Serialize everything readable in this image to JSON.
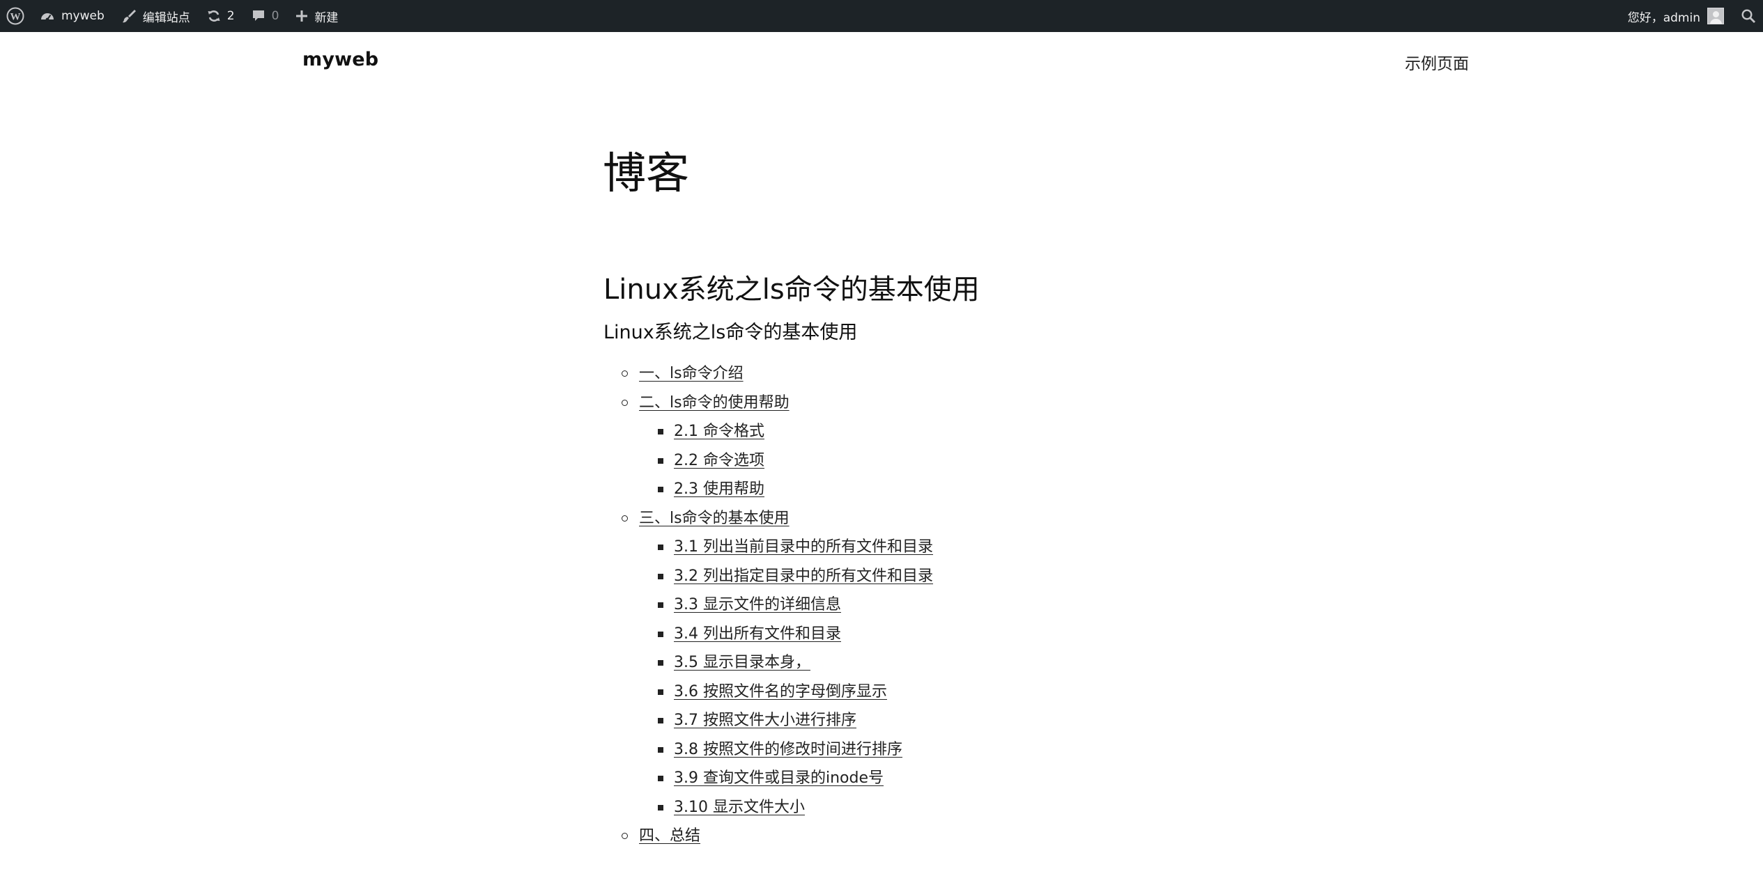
{
  "admin_bar": {
    "site_name": "myweb",
    "edit_site": "编辑站点",
    "updates_count": "2",
    "comments_count": "0",
    "new_label": "新建",
    "greeting": "您好，admin"
  },
  "header": {
    "site_title": "myweb",
    "nav_items": [
      "示例页面"
    ]
  },
  "main": {
    "page_title": "博客",
    "post_title": "Linux系统之ls命令的基本使用",
    "post_subtitle": "Linux系统之ls命令的基本使用",
    "toc": [
      {
        "level": 1,
        "text": "一、ls命令介绍"
      },
      {
        "level": 1,
        "text": "二、ls命令的使用帮助"
      },
      {
        "level": 2,
        "text": "2.1 命令格式"
      },
      {
        "level": 2,
        "text": "2.2 命令选项"
      },
      {
        "level": 2,
        "text": "2.3 使用帮助"
      },
      {
        "level": 1,
        "text": "三、ls命令的基本使用"
      },
      {
        "level": 2,
        "text": "3.1 列出当前目录中的所有文件和目录"
      },
      {
        "level": 2,
        "text": "3.2 列出指定目录中的所有文件和目录"
      },
      {
        "level": 2,
        "text": "3.3 显示文件的详细信息"
      },
      {
        "level": 2,
        "text": "3.4 列出所有文件和目录"
      },
      {
        "level": 2,
        "text": "3.5 显示目录本身，"
      },
      {
        "level": 2,
        "text": "3.6 按照文件名的字母倒序显示"
      },
      {
        "level": 2,
        "text": "3.7 按照文件大小进行排序"
      },
      {
        "level": 2,
        "text": "3.8 按照文件的修改时间进行排序"
      },
      {
        "level": 2,
        "text": "3.9 查询文件或目录的inode号"
      },
      {
        "level": 2,
        "text": "3.10 显示文件大小"
      },
      {
        "level": 1,
        "text": "四、总结"
      }
    ]
  },
  "colors": {
    "admin_bar_bg": "#1d2327",
    "admin_bar_text": "#f0f0f1",
    "text": "#111111"
  }
}
